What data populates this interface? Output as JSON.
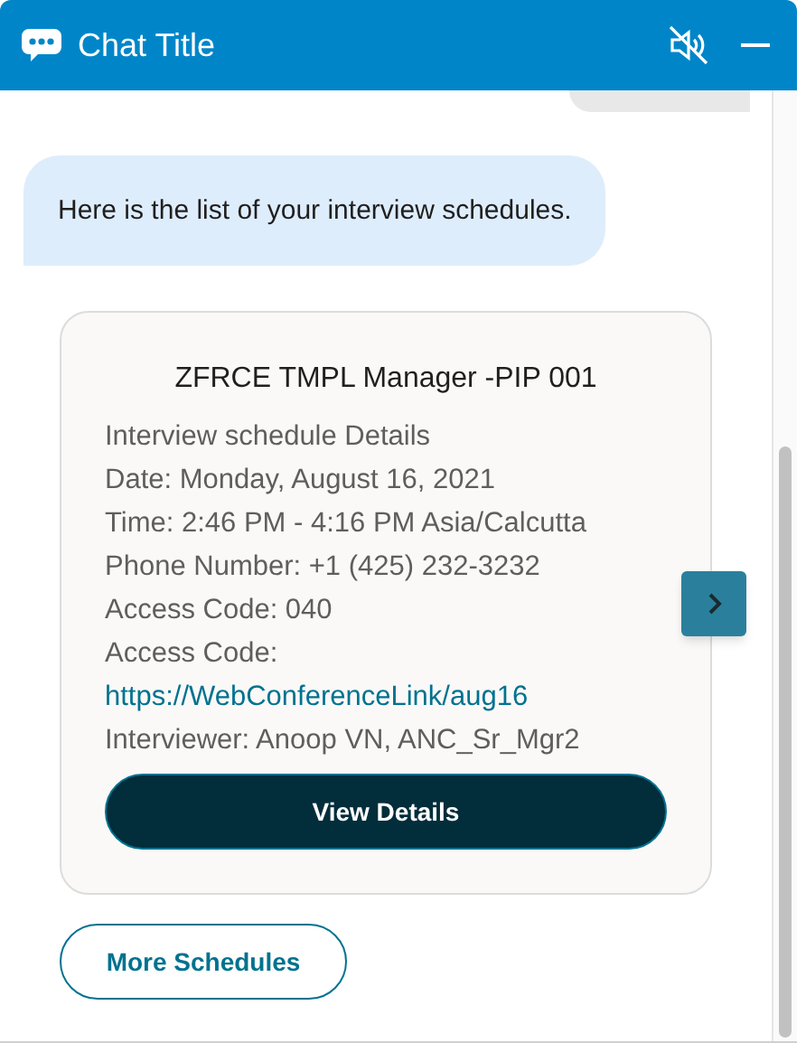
{
  "header": {
    "title": "Chat Title"
  },
  "messages": [
    {
      "kind": "bot",
      "text": "Here is the list of your interview schedules."
    }
  ],
  "card": {
    "title": "ZFRCE TMPL Manager -PIP 001",
    "lines": [
      {
        "kind": "text",
        "text": "Interview schedule Details"
      },
      {
        "kind": "text",
        "text": "Date: Monday, August 16, 2021"
      },
      {
        "kind": "text",
        "text": "Time: 2:46 PM - 4:16 PM Asia/Calcutta"
      },
      {
        "kind": "text",
        "text": "Phone Number: +1 (425) 232-3232"
      },
      {
        "kind": "text",
        "text": "Access Code: 040"
      },
      {
        "kind": "text",
        "text": "Access Code:"
      },
      {
        "kind": "link",
        "text": "https://WebConferenceLink/aug16"
      },
      {
        "kind": "text",
        "text": "Interviewer: Anoop VN, ANC_Sr_Mgr2"
      }
    ],
    "button": "View Details"
  },
  "more_button": "More Schedules"
}
